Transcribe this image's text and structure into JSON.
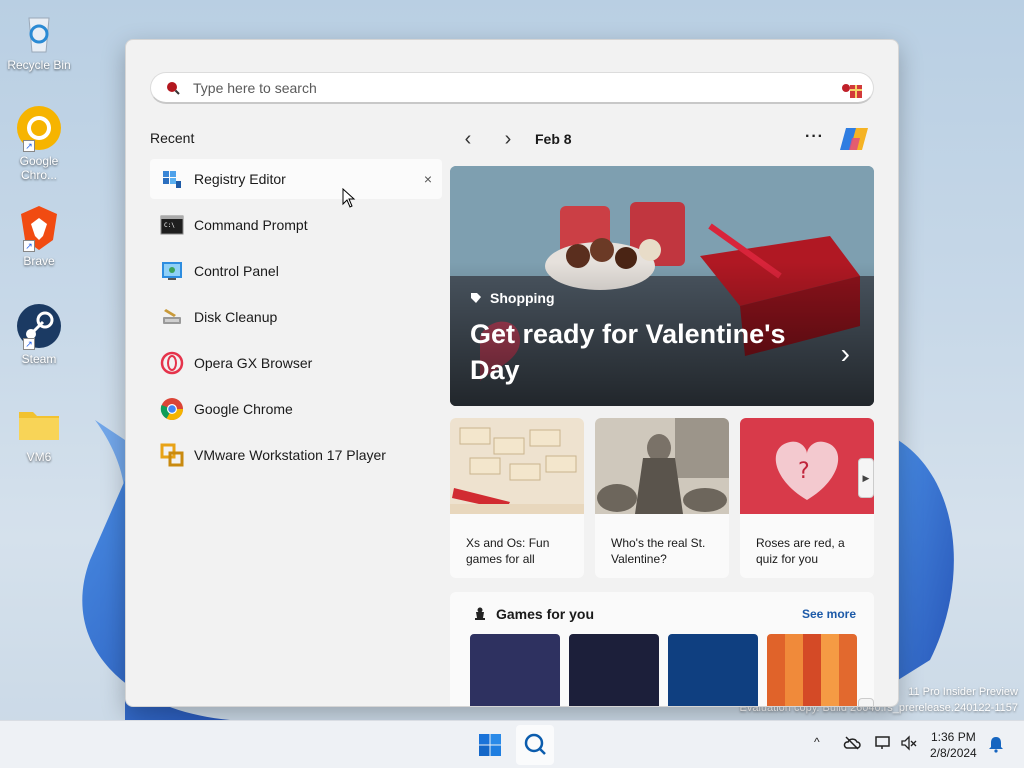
{
  "desktop": {
    "icons": [
      {
        "label": "Recycle Bin",
        "icon": "recycle-bin-icon"
      },
      {
        "label": "Google\nChro...",
        "icon": "chrome-icon"
      },
      {
        "label": "Brave",
        "icon": "brave-icon"
      },
      {
        "label": "Steam",
        "icon": "steam-icon"
      },
      {
        "label": "VM6",
        "icon": "folder-icon"
      }
    ],
    "watermark_line1": "11 Pro Insider Preview",
    "watermark_line2": "Evaluation copy. Build 26040.rs_prerelease.240122-1157"
  },
  "search": {
    "placeholder": "Type here to search",
    "value": ""
  },
  "recent": {
    "title": "Recent",
    "items": [
      {
        "label": "Registry Editor",
        "icon": "registry-editor-icon",
        "close": "×"
      },
      {
        "label": "Command Prompt",
        "icon": "command-prompt-icon"
      },
      {
        "label": "Control Panel",
        "icon": "control-panel-icon"
      },
      {
        "label": "Disk Cleanup",
        "icon": "disk-cleanup-icon"
      },
      {
        "label": "Opera GX Browser",
        "icon": "opera-gx-icon"
      },
      {
        "label": "Google Chrome",
        "icon": "chrome-icon"
      },
      {
        "label": "VMware Workstation 17 Player",
        "icon": "vmware-icon"
      }
    ]
  },
  "feed": {
    "prev": "‹",
    "next": "›",
    "date": "Feb 8",
    "more": "···",
    "hero": {
      "category": "Shopping",
      "title": "Get ready for Valentine's Day",
      "chevron": "›"
    },
    "cards": [
      {
        "text": "Xs and Os: Fun games for all"
      },
      {
        "text": "Who's the real St. Valentine?"
      },
      {
        "text": "Roses are red, a quiz for you"
      }
    ],
    "games": {
      "title": "Games for you",
      "see_more": "See more",
      "tile_colors": [
        "#2e3160",
        "#1c1f3a",
        "#0f3f80",
        "#e0632a"
      ]
    }
  },
  "taskbar": {
    "time": "1:36 PM",
    "date": "2/8/2024",
    "tray_chevron": "^"
  },
  "colors": {
    "accent": "#0067c0",
    "link": "#1d5aa8"
  }
}
